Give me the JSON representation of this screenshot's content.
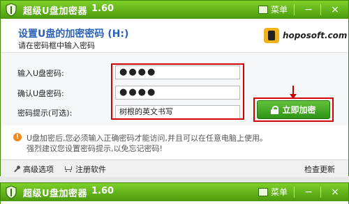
{
  "window": {
    "title": "超级U盘加密器",
    "version": "1.60",
    "menu_label": "菜单",
    "minimize": "−",
    "close": "×"
  },
  "header": {
    "title": "设置U盘的加密密码 (H:)",
    "subtitle": "请在密码框中输入密码",
    "brand": "hoposoft.com"
  },
  "form": {
    "password_label": "输入U盘密码:",
    "password_value": "●●●●",
    "confirm_label": "确认U盘密码:",
    "confirm_value": "●●●●",
    "hint_label": "密码提示(可选):",
    "hint_value": "树根的英文书写",
    "lock_button": "立即加密"
  },
  "notice": {
    "line1": "U盘加密后,您必须输入正确密码才能访问,并且可以在任意电脑上使用。",
    "line2": "强烈建议您设置密码提示,以免忘记密码!"
  },
  "footer": {
    "advanced": "高级选项",
    "register": "注册软件",
    "update": "检查更新"
  },
  "colors": {
    "title_green": "#4a9a0c",
    "accent_blue": "#2b62b7",
    "highlight_red": "#d40000"
  }
}
